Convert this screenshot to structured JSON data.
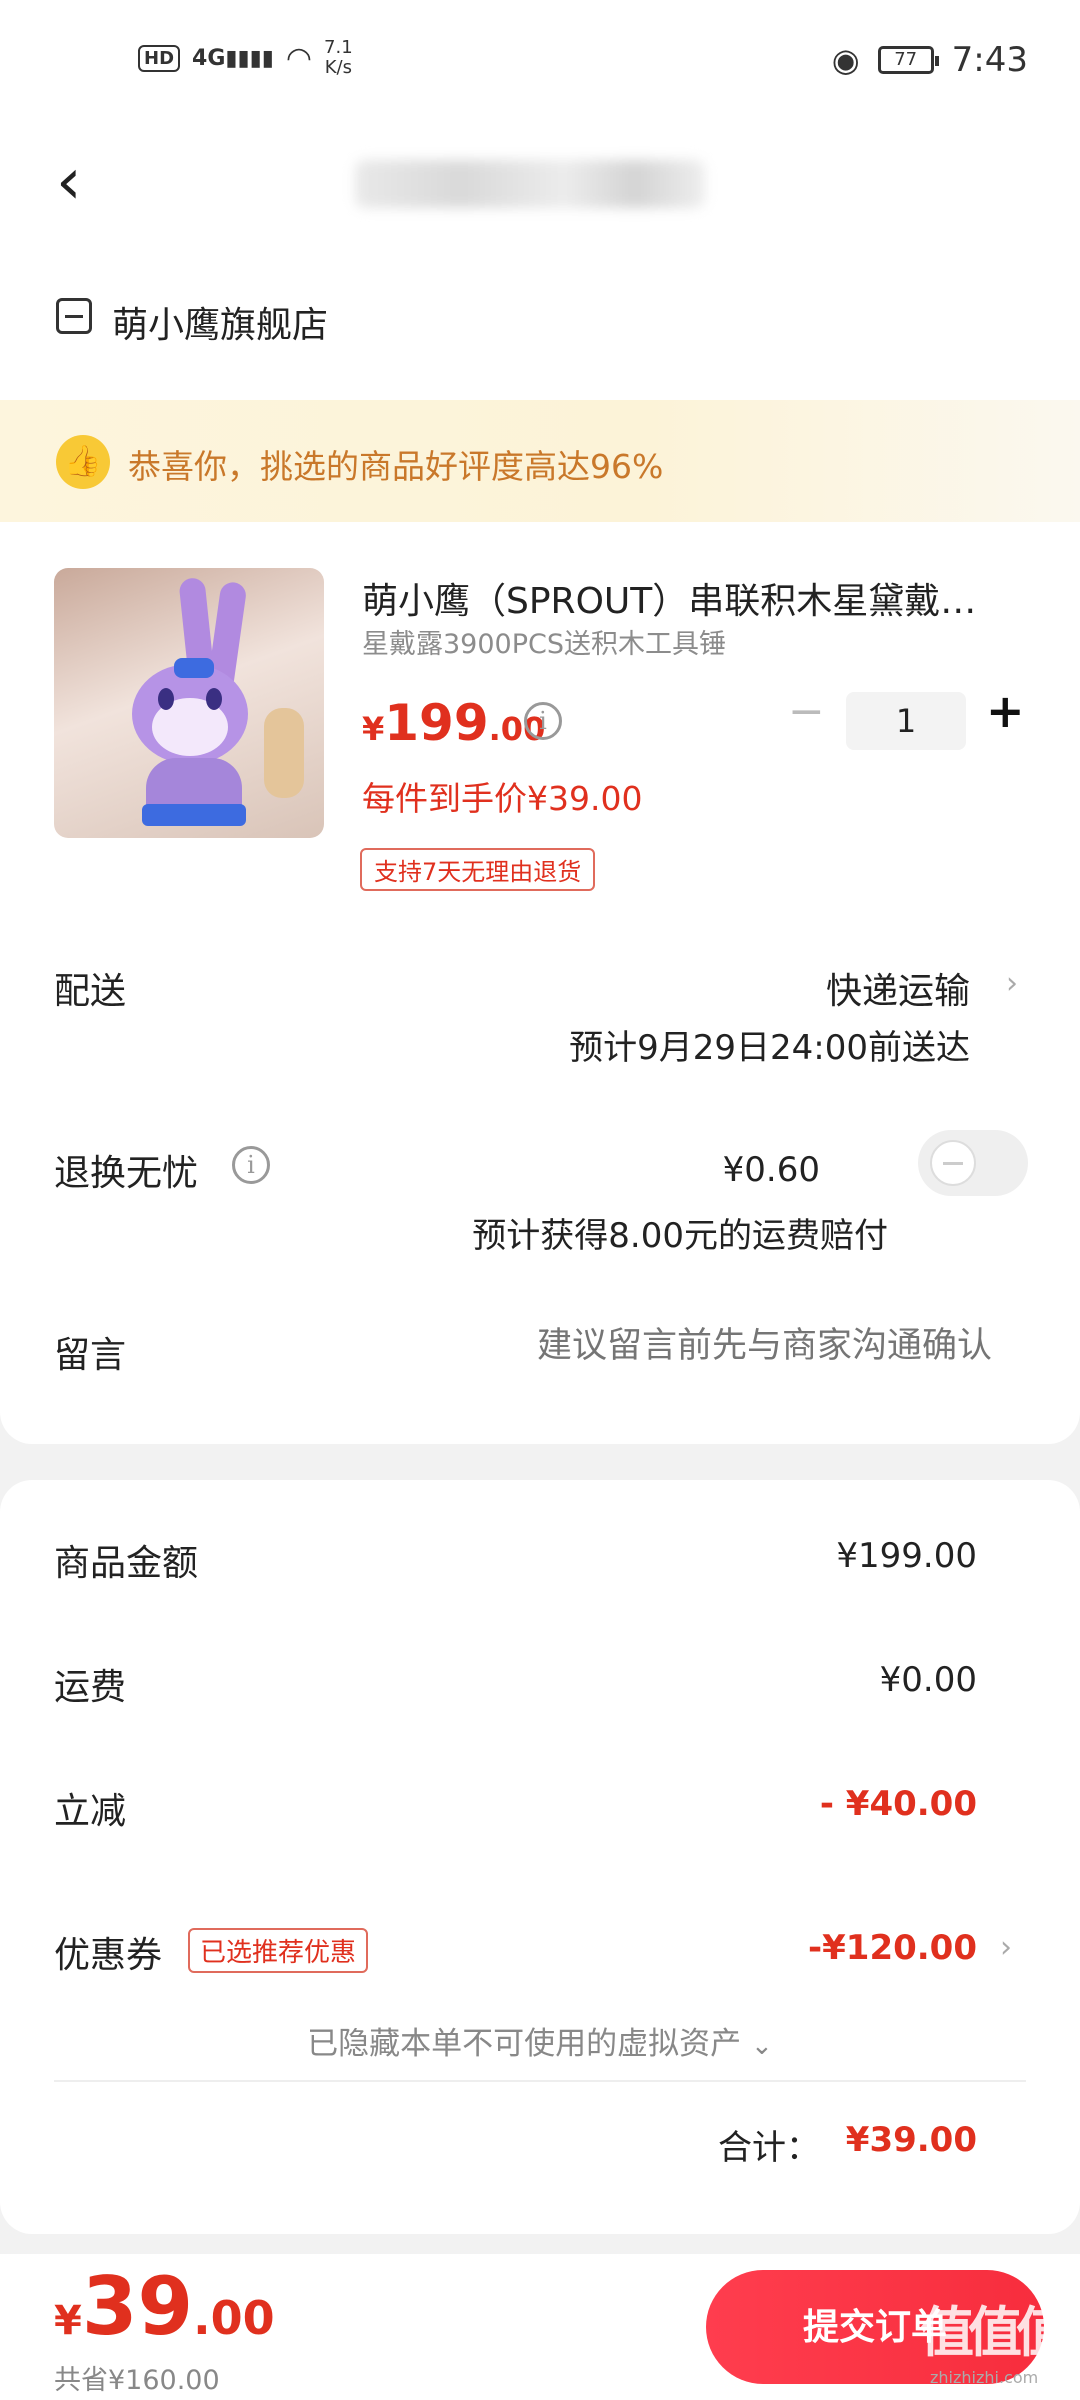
{
  "status_bar": {
    "hd": "HD",
    "signal": "4G",
    "net_speed_value": "7.1",
    "net_speed_unit": "K/s",
    "battery": "77",
    "time": "7:43"
  },
  "header": {
    "back_icon": "chevron-left-icon"
  },
  "store": {
    "name": "萌小鹰旗舰店",
    "icon": "store-icon"
  },
  "banner": {
    "icon": "thumbs-up-icon",
    "text": "恭喜你，挑选的商品好评度高达96%"
  },
  "product": {
    "title": "萌小鹰（SPROUT）串联积木星黛戴…",
    "spec": "星戴露3900PCS送积木工具锤",
    "price_currency": "¥",
    "price_int": "199",
    "price_dec": ".00",
    "quantity": "1",
    "final_price": "每件到手价¥39.00",
    "return_tag": "支持7天无理由退货"
  },
  "shipping": {
    "label": "配送",
    "method": "快递运输",
    "eta": "预计9月29日24:00前送达"
  },
  "return_insurance": {
    "label": "退换无忧",
    "price": "¥0.60",
    "note": "预计获得8.00元的运费赔付",
    "enabled": false
  },
  "message": {
    "label": "留言",
    "placeholder": "建议留言前先与商家沟通确认"
  },
  "summary": {
    "goods_label": "商品金额",
    "goods_value": "¥199.00",
    "shipping_label": "运费",
    "shipping_value": "¥0.00",
    "discount_label": "立减",
    "discount_value": "- ¥40.00",
    "coupon_label": "优惠券",
    "coupon_tag": "已选推荐优惠",
    "coupon_value": "-¥120.00",
    "hidden_note": "已隐藏本单不可使用的虚拟资产",
    "total_label": "合计：",
    "total_value": "¥39.00"
  },
  "bottom_bar": {
    "currency": "¥",
    "price_int": "39",
    "price_dec": ".00",
    "saved": "共省¥160.00",
    "submit_label": "提交订单",
    "watermark": "值值值",
    "watermark_sub": "zhizhizhi.com"
  },
  "colors": {
    "accent_red": "#e0301e",
    "button_red": "#f72d3d",
    "banner_bg": "#fdf5dd",
    "banner_text": "#c9782a"
  }
}
